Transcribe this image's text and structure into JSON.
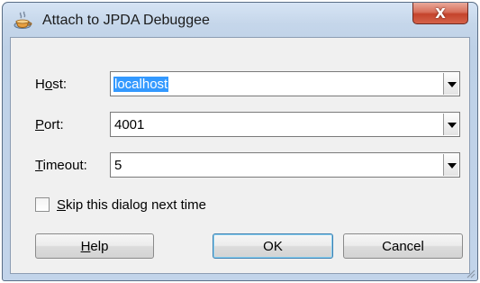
{
  "window": {
    "title": "Attach to JPDA Debuggee",
    "close_label": "X",
    "app_icon": "coffee-cup-icon"
  },
  "form": {
    "host": {
      "label_mnemonic_pre": "H",
      "label_mnemonic": "o",
      "label_post": "st:",
      "value": "localhost",
      "selected": true
    },
    "port": {
      "label_mnemonic_pre": "",
      "label_mnemonic": "P",
      "label_post": "ort:",
      "value": "4001"
    },
    "timeout": {
      "label_mnemonic_pre": "",
      "label_mnemonic": "T",
      "label_post": "imeout:",
      "value": "5"
    }
  },
  "skip_dialog": {
    "label_mnemonic": "S",
    "label_post": "kip this dialog next time",
    "checked": false
  },
  "buttons": {
    "help_mnemonic": "H",
    "help_post": "elp",
    "ok": "OK",
    "cancel": "Cancel"
  },
  "colors": {
    "selection": "#3399ff",
    "close_button": "#c4432c",
    "title_bar": "#c5d6ea"
  }
}
